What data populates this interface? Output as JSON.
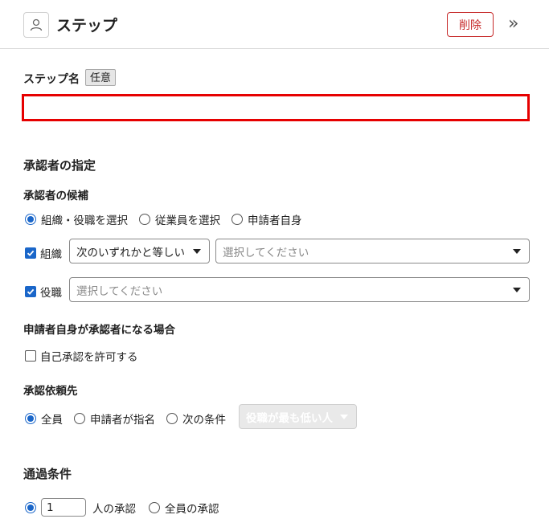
{
  "header": {
    "title": "ステップ",
    "delete_label": "削除",
    "expand_label": "»"
  },
  "step_name": {
    "label": "ステップ名",
    "badge": "任意",
    "value": ""
  },
  "approver_spec": {
    "title": "承認者の指定",
    "candidates_label": "承認者の候補",
    "options": [
      "組織・役職を選択",
      "従業員を選択",
      "申請者自身"
    ],
    "selected_index": 0,
    "org_label": "組織",
    "org_condition": "次のいずれかと等しい",
    "org_placeholder": "選択してください",
    "position_label": "役職",
    "position_placeholder": "選択してください"
  },
  "self_approval": {
    "title": "申請者自身が承認者になる場合",
    "checkbox_label": "自己承認を許可する",
    "checked": false
  },
  "request_target": {
    "title": "承認依頼先",
    "options": [
      "全員",
      "申請者が指名",
      "次の条件"
    ],
    "selected_index": 0,
    "condition_value": "役職が最も低い人"
  },
  "pass_condition": {
    "title": "通過条件",
    "count_value": "1",
    "count_suffix": "人の承認",
    "all_label": "全員の承認"
  },
  "colors": {
    "accent": "#1a66c9",
    "danger": "#c62828",
    "error_border": "#e60000"
  }
}
